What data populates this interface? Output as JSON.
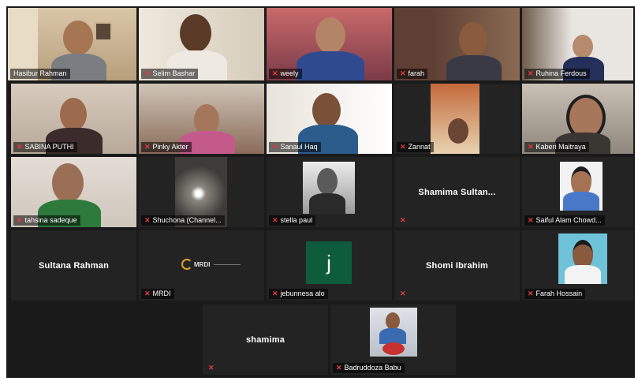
{
  "participants": [
    {
      "name": "Hasibur Rahman",
      "muted": false,
      "active": true
    },
    {
      "name": "Selim Bashar",
      "muted": true
    },
    {
      "name": "weely",
      "muted": true
    },
    {
      "name": "farah",
      "muted": true
    },
    {
      "name": "Ruhina Ferdous",
      "muted": true
    },
    {
      "name": "SABINA PUTHI",
      "muted": true
    },
    {
      "name": "Pinky Akter",
      "muted": true
    },
    {
      "name": "Sanaul Haq",
      "muted": true
    },
    {
      "name": "Zannat",
      "muted": true
    },
    {
      "name": "Kaberi Maitraya",
      "muted": true
    },
    {
      "name": "tahsina sadeque",
      "muted": true
    },
    {
      "name": "Shuchona (Channel...",
      "muted": true
    },
    {
      "name": "stella paul",
      "muted": true
    },
    {
      "name": "Shamima  Sultan...",
      "muted": true,
      "video_off": true
    },
    {
      "name": "Saiful Alam Chowd...",
      "muted": true
    },
    {
      "name": "Sultana Rahman",
      "muted": false,
      "video_off": true
    },
    {
      "name": "MRDI",
      "muted": true,
      "logo_text": "MRDI"
    },
    {
      "name": "jebunnesa alo",
      "muted": true,
      "initial": "j"
    },
    {
      "name": "Shomi Ibrahim",
      "muted": true,
      "video_off": true
    },
    {
      "name": "Farah Hossain",
      "muted": true
    },
    {
      "name": "shamima",
      "muted": true,
      "video_off": true
    },
    {
      "name": "Badruddoza Babu",
      "muted": true
    }
  ],
  "icons": {
    "mic_muted": "mic-muted-icon"
  },
  "colors": {
    "active_speaker": "#c8d63a",
    "muted_mic": "#e33b3b",
    "tile_bg": "#232323"
  }
}
